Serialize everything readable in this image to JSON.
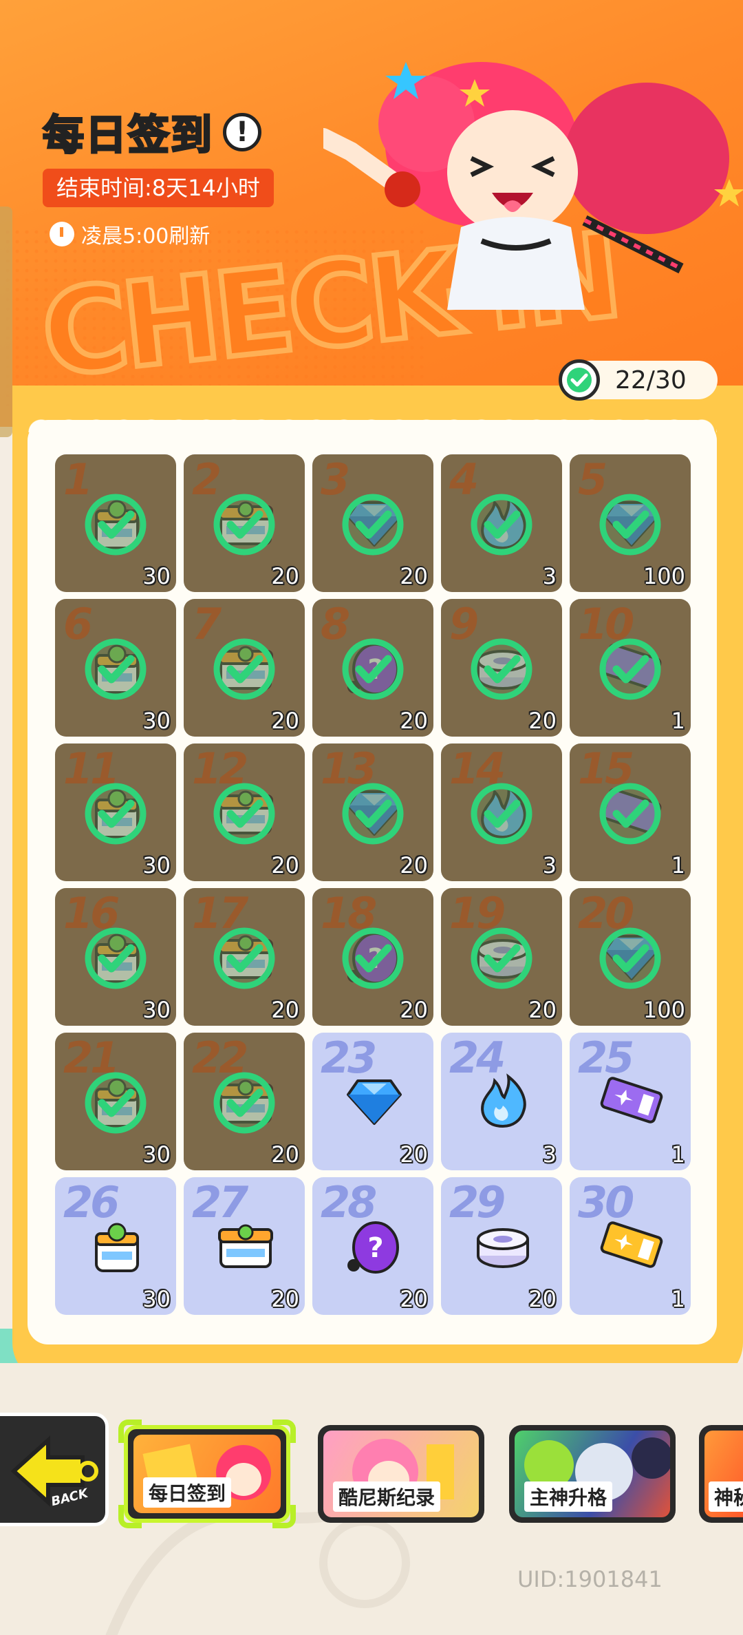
{
  "header": {
    "title": "每日签到",
    "info_icon": "!",
    "end_time": "结束时间:8天14小时",
    "refresh_text": "凌晨5:00刷新",
    "banner_text": "CHECK-IN",
    "progress": "22/30"
  },
  "days": [
    {
      "day": "1",
      "qty": "30",
      "icon": "bucket-icon",
      "claimed": true
    },
    {
      "day": "2",
      "qty": "20",
      "icon": "box-icon",
      "claimed": true
    },
    {
      "day": "3",
      "qty": "20",
      "icon": "gem-icon",
      "claimed": true
    },
    {
      "day": "4",
      "qty": "3",
      "icon": "flame-icon",
      "claimed": true
    },
    {
      "day": "5",
      "qty": "100",
      "icon": "gem-icon",
      "claimed": true
    },
    {
      "day": "6",
      "qty": "30",
      "icon": "bucket-icon",
      "claimed": true
    },
    {
      "day": "7",
      "qty": "20",
      "icon": "box-icon",
      "claimed": true
    },
    {
      "day": "8",
      "qty": "20",
      "icon": "mystery-egg-icon",
      "claimed": true
    },
    {
      "day": "9",
      "qty": "20",
      "icon": "can-icon",
      "claimed": true
    },
    {
      "day": "10",
      "qty": "1",
      "icon": "ticket-icon",
      "claimed": true
    },
    {
      "day": "11",
      "qty": "30",
      "icon": "bucket-icon",
      "claimed": true
    },
    {
      "day": "12",
      "qty": "20",
      "icon": "box-icon",
      "claimed": true
    },
    {
      "day": "13",
      "qty": "20",
      "icon": "gem-icon",
      "claimed": true
    },
    {
      "day": "14",
      "qty": "3",
      "icon": "flame-icon",
      "claimed": true
    },
    {
      "day": "15",
      "qty": "1",
      "icon": "ticket-icon",
      "claimed": true
    },
    {
      "day": "16",
      "qty": "30",
      "icon": "bucket-icon",
      "claimed": true
    },
    {
      "day": "17",
      "qty": "20",
      "icon": "box-icon",
      "claimed": true
    },
    {
      "day": "18",
      "qty": "20",
      "icon": "mystery-egg-icon",
      "claimed": true
    },
    {
      "day": "19",
      "qty": "20",
      "icon": "can-icon",
      "claimed": true
    },
    {
      "day": "20",
      "qty": "100",
      "icon": "gem-icon",
      "claimed": true
    },
    {
      "day": "21",
      "qty": "30",
      "icon": "bucket-icon",
      "claimed": true
    },
    {
      "day": "22",
      "qty": "20",
      "icon": "box-icon",
      "claimed": true
    },
    {
      "day": "23",
      "qty": "20",
      "icon": "gem-icon",
      "claimed": false
    },
    {
      "day": "24",
      "qty": "3",
      "icon": "flame-icon",
      "claimed": false
    },
    {
      "day": "25",
      "qty": "1",
      "icon": "purple-ticket-icon",
      "claimed": false
    },
    {
      "day": "26",
      "qty": "30",
      "icon": "bucket-icon",
      "claimed": false
    },
    {
      "day": "27",
      "qty": "20",
      "icon": "box-icon",
      "claimed": false
    },
    {
      "day": "28",
      "qty": "20",
      "icon": "mystery-egg-icon",
      "claimed": false
    },
    {
      "day": "29",
      "qty": "20",
      "icon": "can-icon",
      "claimed": false
    },
    {
      "day": "30",
      "qty": "1",
      "icon": "gold-ticket-icon",
      "claimed": false
    }
  ],
  "nav": {
    "back_label": "BACK",
    "items": [
      {
        "label": "每日签到",
        "active": true
      },
      {
        "label": "酷尼斯纪录",
        "active": false
      },
      {
        "label": "主神升格",
        "active": false
      },
      {
        "label": "神秘",
        "active": false
      }
    ]
  },
  "uid": "UID:1901841",
  "colors": {
    "header_orange": "#ff8a2a",
    "board_yellow": "#ffc94a",
    "claimed_cell": "#7d6a4a",
    "pending_cell": "#c8d0f5",
    "check_green": "#2fd37a",
    "nav_active_border": "#c8f52e"
  }
}
